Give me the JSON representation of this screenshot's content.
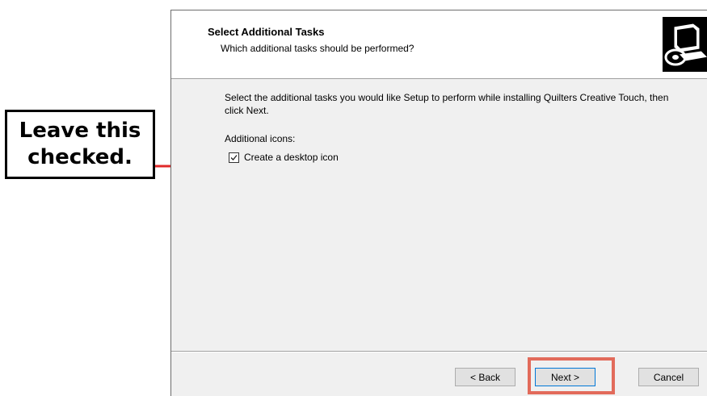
{
  "annotation": {
    "line1": "Leave this",
    "line2": "checked."
  },
  "wizard": {
    "header": {
      "title": "Select Additional Tasks",
      "subtitle": "Which additional tasks should be performed?"
    },
    "body": {
      "description": "Select the additional tasks you would like Setup to perform while installing Quilters Creative Touch, then click Next.",
      "group_label": "Additional icons:",
      "tasks": [
        {
          "label": "Create a desktop icon",
          "checked": true
        }
      ]
    },
    "buttons": {
      "back": "< Back",
      "next": "Next >",
      "cancel": "Cancel"
    }
  },
  "colors": {
    "highlight": "#e26b5b",
    "arrow": "#e02a2a",
    "primary_button_border": "#0078d7"
  }
}
